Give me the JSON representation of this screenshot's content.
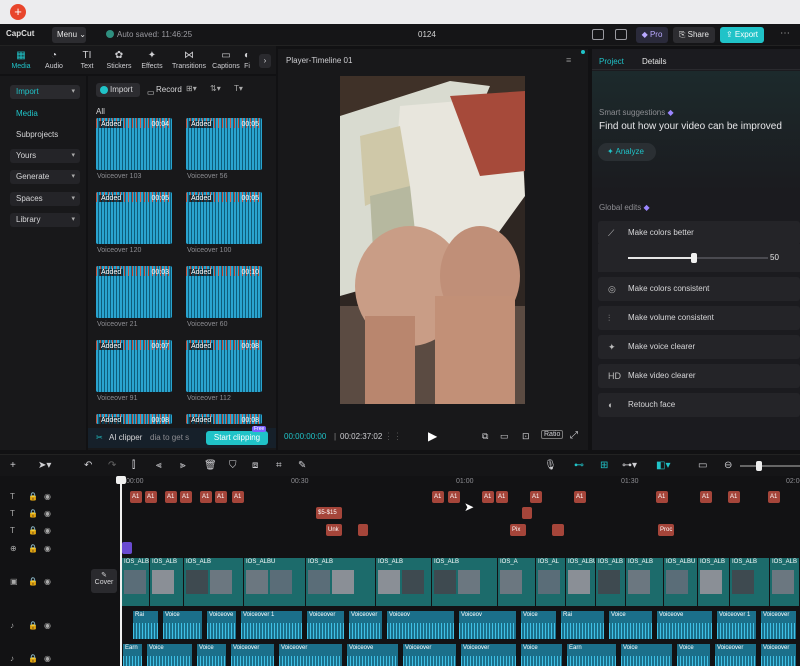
{
  "os": {
    "plus_label": "+"
  },
  "topbar": {
    "logo": "CapCut",
    "menu_label": "Menu",
    "autosave_text": "Auto saved: 11:46:25",
    "project_name": "0124",
    "pro_label": "Pro",
    "share_label": "Share",
    "export_label": "Export"
  },
  "tool_tabs": [
    {
      "label": "Media",
      "icon": "media-icon",
      "glyph": "▦"
    },
    {
      "label": "Audio",
      "icon": "audio-icon",
      "glyph": "◔"
    },
    {
      "label": "Text",
      "icon": "text-icon",
      "glyph": "TI"
    },
    {
      "label": "Stickers",
      "icon": "stickers-icon",
      "glyph": "✿"
    },
    {
      "label": "Effects",
      "icon": "effects-icon",
      "glyph": "✦"
    },
    {
      "label": "Transitions",
      "icon": "transitions-icon",
      "glyph": "⋈"
    },
    {
      "label": "Captions",
      "icon": "captions-icon",
      "glyph": "▭"
    },
    {
      "label": "Fi",
      "icon": "filters-icon",
      "glyph": "◐"
    }
  ],
  "leftnav": {
    "import": "Import",
    "media": "Media",
    "subprojects": "Subprojects",
    "yours": "Yours",
    "generate": "Generate",
    "spaces": "Spaces",
    "library": "Library"
  },
  "media_panel": {
    "import_btn": "Import",
    "record_btn": "Record",
    "filter_all": "All",
    "items": [
      {
        "added": "Added",
        "duration": "00:04",
        "name": "Voiceover 103"
      },
      {
        "added": "Added",
        "duration": "00:05",
        "name": "Voiceover 56"
      },
      {
        "added": "Added",
        "duration": "00:05",
        "name": "Voiceover 120"
      },
      {
        "added": "Added",
        "duration": "00:05",
        "name": "Voiceover 100"
      },
      {
        "added": "Added",
        "duration": "00:03",
        "name": "Voiceover 21"
      },
      {
        "added": "Added",
        "duration": "00:10",
        "name": "Voiceover 60"
      },
      {
        "added": "Added",
        "duration": "00:07",
        "name": "Voiceover 91"
      },
      {
        "added": "Added",
        "duration": "00:08",
        "name": "Voiceover 112"
      },
      {
        "added": "Added",
        "duration": "00:08",
        "name": ""
      },
      {
        "added": "Added",
        "duration": "00:08",
        "name": ""
      }
    ],
    "ai_clipper": "AI clipper",
    "ai_hint": "dia to get s",
    "start_clipping": "Start clipping",
    "start_badge": "Free"
  },
  "player": {
    "title": "Player-Timeline 01",
    "current_time": "00:00:00:00",
    "total_time": "00:02:37:02",
    "ratio_label": "Ratio"
  },
  "right_panel": {
    "tab_project": "Project",
    "tab_details": "Details",
    "smart_title": "Smart suggestions",
    "smart_body": "Find out how your video can be improved",
    "analyze": "Analyze",
    "global_edits": "Global edits",
    "edits": [
      {
        "label": "Make colors better",
        "icon": "magic-wand-icon",
        "glyph": "⟋"
      },
      {
        "label": "Make colors consistent",
        "icon": "palette-icon",
        "glyph": "◎"
      },
      {
        "label": "Make volume consistent",
        "icon": "equalizer-icon",
        "glyph": "⫶"
      },
      {
        "label": "Make voice clearer",
        "icon": "sparkle-icon",
        "glyph": "✦"
      },
      {
        "label": "Make video clearer",
        "icon": "hd-icon",
        "glyph": "HD"
      },
      {
        "label": "Retouch face",
        "icon": "face-icon",
        "glyph": "◐"
      }
    ],
    "slider_value": "50",
    "slider_fraction": 0.5
  },
  "timeline": {
    "ruler": [
      "00:00",
      "00:30",
      "01:00",
      "01:30",
      "02:00"
    ],
    "text_clips": [
      "A1",
      "A1",
      "A1",
      "A1",
      "A1",
      "A1",
      "A1",
      "A1",
      "A1",
      "A1",
      "A1",
      "A1",
      "A1",
      "A1"
    ],
    "mid_clip": "$5-$15",
    "row3_clips": [
      "Unk",
      "Pix",
      "Proc"
    ],
    "cover_label": "Cover",
    "video_clip_labels": [
      "IOS_ALBU",
      "IOS_ALB",
      "IOS_ALB",
      "IOS_ALBU",
      "IOS_ALB",
      "IOS_ALB",
      "IOS_ALB",
      "IOS_A",
      "IOS_AL"
    ],
    "voice_row1": [
      "Rai",
      "Voice",
      "Voiceove",
      "Voiceover 1",
      "Voiceover",
      "Voiceover",
      "Voiceov",
      "Voiceov",
      "Voice"
    ],
    "voice_row2": [
      "Earn",
      "Voice",
      "Voice",
      "Voiceover",
      "Voiceover",
      "Voiceove",
      "Voiceover",
      "Voiceover",
      "Voice"
    ]
  },
  "colors": {
    "accent": "#20c3c8",
    "clip_red": "#a5453a",
    "audio": "#1b6f8a"
  }
}
